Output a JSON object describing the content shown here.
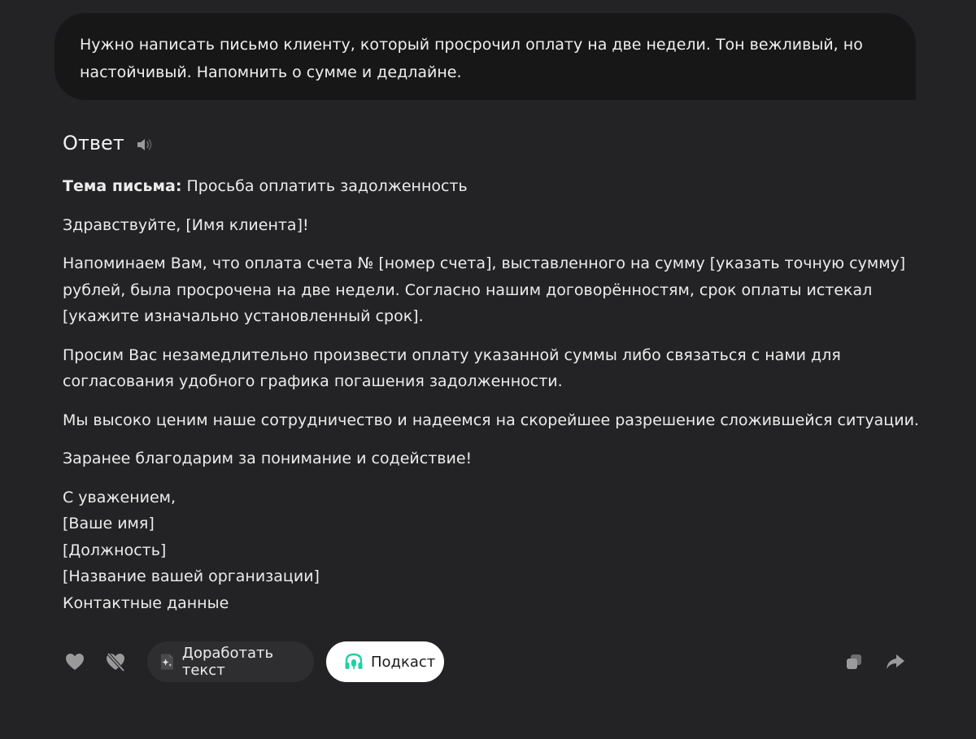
{
  "user_message": {
    "text": "Нужно написать письмо клиенту, который просрочил оплату на две недели. Тон вежливый, но настойчивый. Напомнить о сумме и дедлайне."
  },
  "answer": {
    "title": "Ответ",
    "subject_label": "Тема письма:",
    "subject_text": " Просьба оплатить задолженность",
    "greeting": "Здравствуйте, [Имя клиента]!",
    "paragraph_1": "Напоминаем Вам, что оплата счета № [номер счета], выставленного на сумму [указать точную сумму] рублей, была просрочена на две недели. Согласно нашим договорённостям, срок оплаты истекал [укажите изначально установленный срок].",
    "paragraph_2": "Просим Вас незамедлительно произвести оплату указанной суммы либо связаться с нами для согласования удобного графика погашения задолженности.",
    "paragraph_3": "Мы высоко ценим наше сотрудничество и надеемся на скорейшее разрешение сложившейся ситуации.",
    "paragraph_4": "Заранее благодарим за понимание и содействие!",
    "signature": [
      "С уважением,",
      "[Ваше имя]",
      "[Должность]",
      "[Название вашей организации]",
      "Контактные данные"
    ]
  },
  "toolbar": {
    "refine_label": "Доработать текст",
    "podcast_label": "Подкаст"
  },
  "icons": {
    "like": "heart-icon",
    "dislike": "broken-heart-icon",
    "speaker": "speaker-icon",
    "refine": "sparkle-document-icon",
    "podcast": "headphones-icon",
    "copy": "copy-icon",
    "share": "share-arrow-icon"
  },
  "colors": {
    "background": "#232325",
    "user_bubble": "#171717",
    "podcast_accent": "#1fd1a5",
    "icon_gray": "#9a9a9a"
  }
}
